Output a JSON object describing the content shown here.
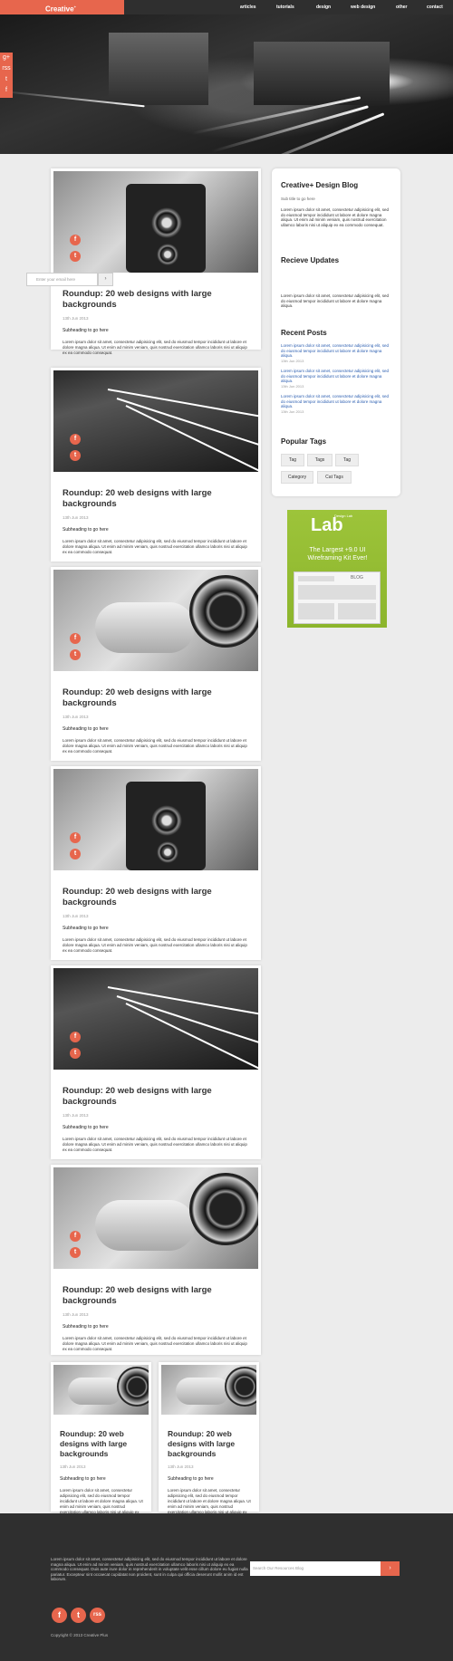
{
  "header": {
    "logo": "Creative",
    "logo_mark": "+",
    "nav": [
      "articles",
      "tutorials",
      "design",
      "web design",
      "other",
      "contact"
    ]
  },
  "hero": {
    "social": [
      "g+",
      "rss",
      "t",
      "f"
    ]
  },
  "posts": [
    {
      "title": "Roundup: 20 web designs with large backgrounds",
      "date": "13th Jun 2013",
      "sub": "Subheading to go here",
      "body": "Lorem ipsum dolor sit amet, consectetur adipisicing elit, sed do eiusmod tempor incididunt ut labore et dolore magna aliqua. Ut enim ad minim veniam, quis nostrud exercitation ullamco laboris nisi ut aliquip ex ea commodo consequat."
    },
    {
      "title": "Roundup: 20 web designs with large backgrounds",
      "date": "13th Jun 2013",
      "sub": "Subheading to go here",
      "body": "Lorem ipsum dolor sit amet, consectetur adipisicing elit, sed do eiusmod tempor incididunt ut labore et dolore magna aliqua. Ut enim ad minim veniam, quis nostrud exercitation ullamco laboris nisi ut aliquip ex ea commodo consequat."
    },
    {
      "title": "Roundup: 20 web designs with large backgrounds",
      "date": "13th Jun 2013",
      "sub": "Subheading to go here",
      "body": "Lorem ipsum dolor sit amet, consectetur adipisicing elit, sed do eiusmod tempor incididunt ut labore et dolore magna aliqua. Ut enim ad minim veniam, quis nostrud exercitation ullamco laboris nisi ut aliquip ex ea commodo consequat."
    },
    {
      "title": "Roundup: 20 web designs with large backgrounds",
      "date": "13th Jun 2013",
      "sub": "Subheading to go here",
      "body": "Lorem ipsum dolor sit amet, consectetur adipisicing elit, sed do eiusmod tempor incididunt ut labore et dolore magna aliqua. Ut enim ad minim veniam, quis nostrud exercitation ullamco laboris nisi ut aliquip ex ea commodo consequat."
    },
    {
      "title": "Roundup: 20 web designs with large backgrounds",
      "date": "13th Jun 2013",
      "sub": "Subheading to go here",
      "body": "Lorem ipsum dolor sit amet, consectetur adipisicing elit, sed do eiusmod tempor incididunt ut labore et dolore magna aliqua. Ut enim ad minim veniam, quis nostrud exercitation ullamco laboris nisi ut aliquip ex ea commodo consequat."
    },
    {
      "title": "Roundup: 20 web designs with large backgrounds",
      "date": "13th Jun 2013",
      "sub": "Subheading to go here",
      "body": "Lorem ipsum dolor sit amet, consectetur adipisicing elit, sed do eiusmod tempor incididunt ut labore et dolore magna aliqua. Ut enim ad minim veniam, quis nostrud exercitation ullamco laboris nisi ut aliquip ex ea commodo consequat."
    }
  ],
  "mini_posts": [
    {
      "title": "Roundup: 20 web designs with large backgrounds",
      "date": "13th Jun 2013",
      "sub": "Subheading to go here",
      "body": "Lorem ipsum dolor sit amet, consectetur adipisicing elit, sed do eiusmod tempor incididunt ut labore et dolore magna aliqua. Ut enim ad minim veniam, quis nostrud exercitation ullamco laboris nisi ut aliquip ex ea commodo consequat."
    },
    {
      "title": "Roundup: 20 web designs with large backgrounds",
      "date": "13th Jun 2013",
      "sub": "Subheading to go here",
      "body": "Lorem ipsum dolor sit amet, consectetur adipisicing elit, sed do eiusmod tempor incididunt ut labore et dolore magna aliqua. Ut enim ad minim veniam, quis nostrud exercitation ullamco laboris nisi ut aliquip ex ea commodo consequat."
    }
  ],
  "sidebar": {
    "blog_title": "Creative+ Design Blog",
    "blog_sub": "Sub title to go here",
    "blog_text": "Lorem ipsum dolor sit amet, consectetur adipisicing elit, sed do eiusmod tempor incididunt ut labore et dolore magna aliqua. Ut enim ad minim veniam, quis nostrud exercitation ullamco laboris nisi ut aliquip ex ea commodo consequat.",
    "updates_title": "Recieve Updates",
    "updates_placeholder": "Enter your email here",
    "updates_button": "›",
    "updates_text": "Lorem ipsum dolor sit amet, consectetur adipisicing elit, sed do eiusmod tempor incididunt ut labore et dolore magna aliqua.",
    "recent_title": "Recent Posts",
    "recent": [
      {
        "text": "Lorem ipsum dolor sit amet, consectetur adipisicing elit, sed do eiusmod tempor incididunt ut labore et dolore magna aliqua.",
        "meta": "13th Jun 2013"
      },
      {
        "text": "Lorem ipsum dolor sit amet, consectetur adipisicing elit, sed do eiusmod tempor incididunt ut labore et dolore magna aliqua.",
        "meta": "13th Jun 2013"
      },
      {
        "text": "Lorem ipsum dolor sit amet, consectetur adipisicing elit, sed do eiusmod tempor incididunt ut labore et dolore magna aliqua.",
        "meta": "13th Jun 2013"
      }
    ],
    "tags_title": "Popular Tags",
    "tags": [
      "Tag",
      "Tags",
      "Tag",
      "Category",
      "Cat Tags"
    ]
  },
  "ad": {
    "top": "Design Lab",
    "logo": "Lab",
    "cta": "The Largest +9.0 UI Wireframing Kit Ever!",
    "screen_label": "BLOG"
  },
  "footer": {
    "text": "Lorem ipsum dolor sit amet, consectetur adipisicing elit, sed do eiusmod tempor incididunt ut labore et dolore magna aliqua. Ut enim ad minim veniam, quis nostrud exercitation ullamco laboris nisi ut aliquip ex ea commodo consequat. Duis aute irure dolor in reprehenderit in voluptate velit esse cillum dolore eu fugiat nulla pariatur. Excepteur sint occaecat cupidatat non proident, sunt in culpa qui officia deserunt mollit anim id est laborum.",
    "search_placeholder": "Search Our Resources Blog",
    "search_button": "›",
    "social": [
      "f",
      "t",
      "rss"
    ],
    "copyright": "Copyright © 2013 Creative Plus"
  },
  "colors": {
    "accent": "#e7664d",
    "dark": "#2f2f2f",
    "ad_green": "#9dc43a"
  }
}
